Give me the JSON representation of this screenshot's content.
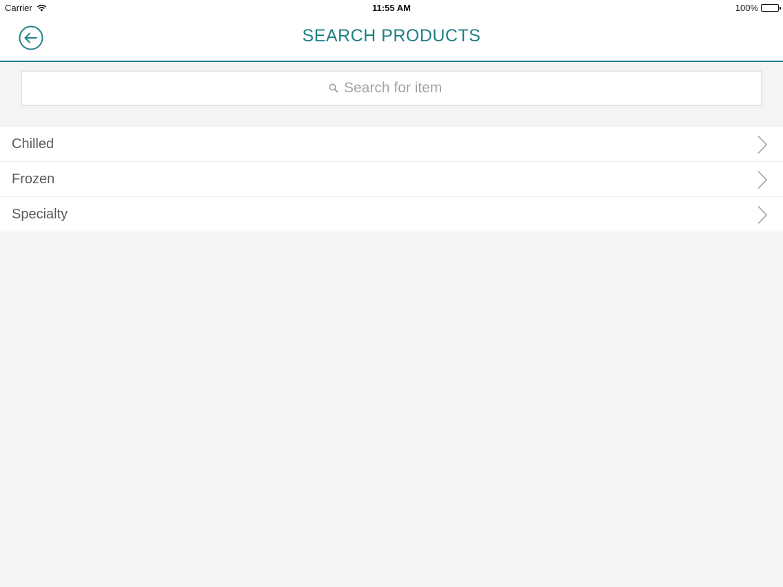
{
  "status_bar": {
    "carrier": "Carrier",
    "time": "11:55 AM",
    "battery": "100%",
    "battery_level": 1.0
  },
  "nav": {
    "title": "SEARCH PRODUCTS",
    "back_icon": "back-arrow-circle-icon",
    "accent_color": "#1e7f85"
  },
  "search": {
    "placeholder": "Search for item",
    "value": "",
    "icon": "search-icon"
  },
  "categories": [
    {
      "label": "Chilled"
    },
    {
      "label": "Frozen"
    },
    {
      "label": "Specialty"
    }
  ]
}
